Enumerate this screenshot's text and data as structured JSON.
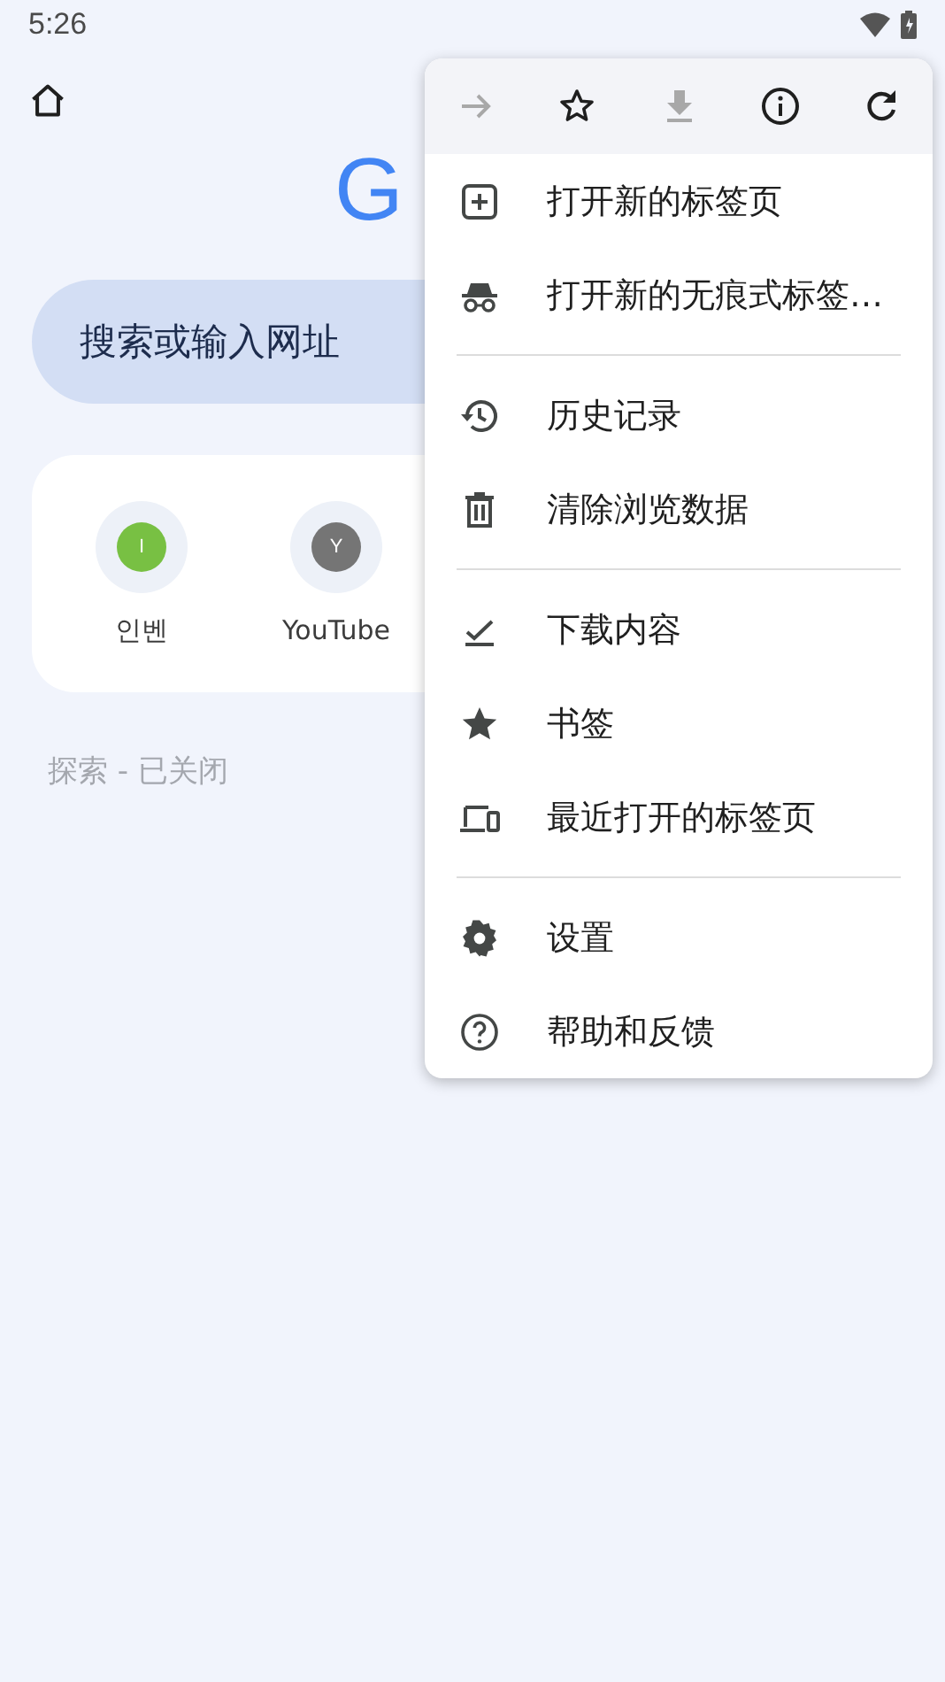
{
  "status_bar": {
    "time": "5:26"
  },
  "logo": "G",
  "search": {
    "placeholder": "搜索或输入网址"
  },
  "shortcuts": [
    {
      "letter": "I",
      "label": "인벤",
      "color": "#78c043"
    },
    {
      "letter": "Y",
      "label": "YouTube",
      "color": "#757575"
    }
  ],
  "discover": "探索 - 已关闭",
  "menu": {
    "toolbar": [
      {
        "kind": "forward",
        "disabled": true
      },
      {
        "kind": "star",
        "disabled": false
      },
      {
        "kind": "download",
        "disabled": true
      },
      {
        "kind": "info",
        "disabled": false
      },
      {
        "kind": "reload",
        "disabled": false
      }
    ],
    "groups": [
      [
        {
          "kind": "new-tab",
          "label": "打开新的标签页"
        },
        {
          "kind": "incognito",
          "label": "打开新的无痕式标签…"
        }
      ],
      [
        {
          "kind": "history",
          "label": "历史记录"
        },
        {
          "kind": "trash",
          "label": "清除浏览数据"
        }
      ],
      [
        {
          "kind": "downloads",
          "label": "下载内容"
        },
        {
          "kind": "bookmark",
          "label": "书签"
        },
        {
          "kind": "devices",
          "label": "最近打开的标签页"
        }
      ],
      [
        {
          "kind": "settings",
          "label": "设置"
        },
        {
          "kind": "help",
          "label": "帮助和反馈"
        }
      ]
    ]
  }
}
